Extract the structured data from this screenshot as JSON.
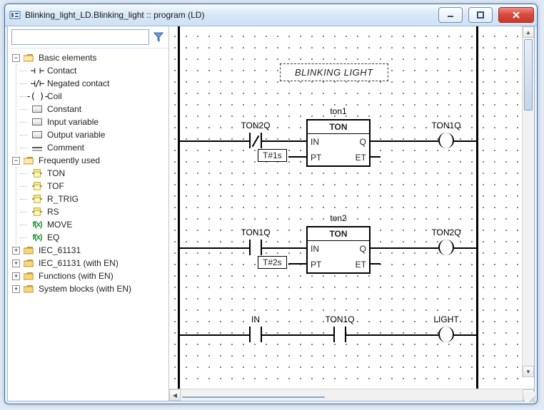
{
  "window": {
    "title": "Blinking_light_LD.Blinking_light :: program (LD)"
  },
  "search": {
    "placeholder": "",
    "value": ""
  },
  "tree": {
    "groups": [
      {
        "key": "basic",
        "label": "Basic elements",
        "expanded": true,
        "children": [
          {
            "key": "contact",
            "label": "Contact",
            "iconKind": "ld",
            "glyph": "⊣  ⊢"
          },
          {
            "key": "ncontact",
            "label": "Negated contact",
            "iconKind": "ld",
            "glyph": "⊣/⊢"
          },
          {
            "key": "coil",
            "label": "Coil",
            "iconKind": "ld",
            "glyph": "-( )-"
          },
          {
            "key": "constant",
            "label": "Constant",
            "iconKind": "block",
            "glyph": ""
          },
          {
            "key": "inputvar",
            "label": "Input variable",
            "iconKind": "block",
            "glyph": ""
          },
          {
            "key": "outputvar",
            "label": "Output variable",
            "iconKind": "block",
            "glyph": ""
          },
          {
            "key": "comment",
            "label": "Comment",
            "iconKind": "comment",
            "glyph": ""
          }
        ]
      },
      {
        "key": "freq",
        "label": "Frequently used",
        "expanded": true,
        "children": [
          {
            "key": "ton",
            "label": "TON",
            "iconKind": "fb",
            "glyph": ""
          },
          {
            "key": "tof",
            "label": "TOF",
            "iconKind": "fb",
            "glyph": ""
          },
          {
            "key": "rtrig",
            "label": "R_TRIG",
            "iconKind": "fb",
            "glyph": ""
          },
          {
            "key": "rs",
            "label": "RS",
            "iconKind": "fb",
            "glyph": ""
          },
          {
            "key": "move",
            "label": "MOVE",
            "iconKind": "fx",
            "glyph": "f(x)"
          },
          {
            "key": "eq",
            "label": "EQ",
            "iconKind": "fx",
            "glyph": "f(x)"
          }
        ]
      },
      {
        "key": "iec",
        "label": "IEC_61131",
        "expanded": false
      },
      {
        "key": "iecen",
        "label": "IEC_61131 (with EN)",
        "expanded": false
      },
      {
        "key": "func",
        "label": "Functions (with EN)",
        "expanded": false
      },
      {
        "key": "sys",
        "label": "System blocks (with EN)",
        "expanded": false
      }
    ]
  },
  "ladder": {
    "comment": "BLINKING LIGHT",
    "rungs": [
      {
        "block": {
          "instance": "ton1",
          "type": "TON",
          "pins": {
            "l1": "IN",
            "r1": "Q",
            "l2": "PT",
            "r2": "ET"
          }
        },
        "inputContact": {
          "label": "TON2Q",
          "nc": true
        },
        "param": "T#1s",
        "outputCoil": {
          "label": "TON1Q"
        }
      },
      {
        "block": {
          "instance": "ton2",
          "type": "TON",
          "pins": {
            "l1": "IN",
            "r1": "Q",
            "l2": "PT",
            "r2": "ET"
          }
        },
        "inputContact": {
          "label": "TON1Q",
          "nc": false
        },
        "param": "T#2s",
        "outputCoil": {
          "label": "TON2Q"
        }
      },
      {
        "contacts": [
          {
            "label": "IN"
          },
          {
            "label": "TON1Q"
          }
        ],
        "outputCoil": {
          "label": "LIGHT"
        }
      }
    ]
  }
}
